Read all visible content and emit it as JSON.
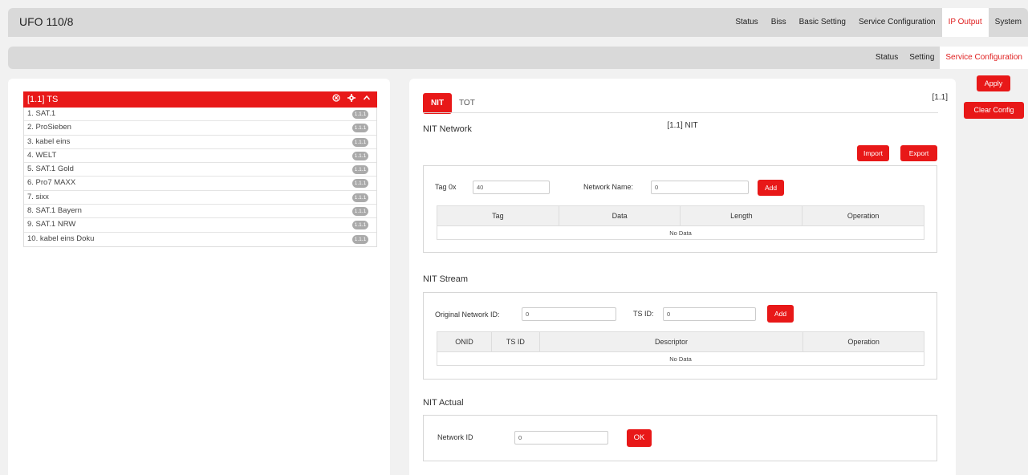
{
  "app": {
    "title": "UFO 110/8"
  },
  "top_nav": [
    "Status",
    "Biss",
    "Basic Setting",
    "Service Configuration",
    "IP Output",
    "System"
  ],
  "sub_nav": [
    "Status",
    "Setting",
    "Service Configuration"
  ],
  "ts": {
    "header": "[1.1] TS",
    "services": [
      {
        "label": "1. SAT.1",
        "badge": "1.1.1"
      },
      {
        "label": "2. ProSieben",
        "badge": "1.1.1"
      },
      {
        "label": "3. kabel eins",
        "badge": "1.1.1"
      },
      {
        "label": "4. WELT",
        "badge": "1.1.1"
      },
      {
        "label": "5. SAT.1 Gold",
        "badge": "1.1.1"
      },
      {
        "label": "6. Pro7 MAXX",
        "badge": "1.1.1"
      },
      {
        "label": "7. sixx",
        "badge": "1.1.1"
      },
      {
        "label": "8. SAT.1 Bayern",
        "badge": "1.1.1"
      },
      {
        "label": "9. SAT.1 NRW",
        "badge": "1.1.1"
      },
      {
        "label": "10. kabel eins Doku",
        "badge": "1.1.1"
      }
    ]
  },
  "main": {
    "tabs": [
      "NIT",
      "TOT"
    ],
    "ts_ref": "[1.1]",
    "subtitle": "[1.1] NIT",
    "nit_network": {
      "title": "NIT Network",
      "import_label": "Import",
      "export_label": "Export",
      "tag_label": "Tag 0x",
      "tag_value": "40",
      "network_name_label": "Network Name:",
      "network_name_value": "0",
      "add_label": "Add",
      "columns": [
        "Tag",
        "Data",
        "Length",
        "Operation"
      ],
      "empty": "No Data"
    },
    "nit_stream": {
      "title": "NIT Stream",
      "onid_label": "Original Network ID:",
      "onid_value": "0",
      "tsid_label": "TS ID:",
      "tsid_value": "0",
      "add_label": "Add",
      "columns": [
        "ONID",
        "TS ID",
        "Descriptor",
        "Operation"
      ],
      "empty": "No Data"
    },
    "nit_actual": {
      "title": "NIT Actual",
      "network_id_label": "Network ID",
      "network_id_value": "0",
      "ok_label": "OK"
    }
  },
  "side_actions": {
    "apply": "Apply",
    "clear": "Clear Config"
  },
  "colors": {
    "accent": "#e81818",
    "active_tab_text": "#e02020",
    "bar_bg": "#d9d9d9"
  }
}
